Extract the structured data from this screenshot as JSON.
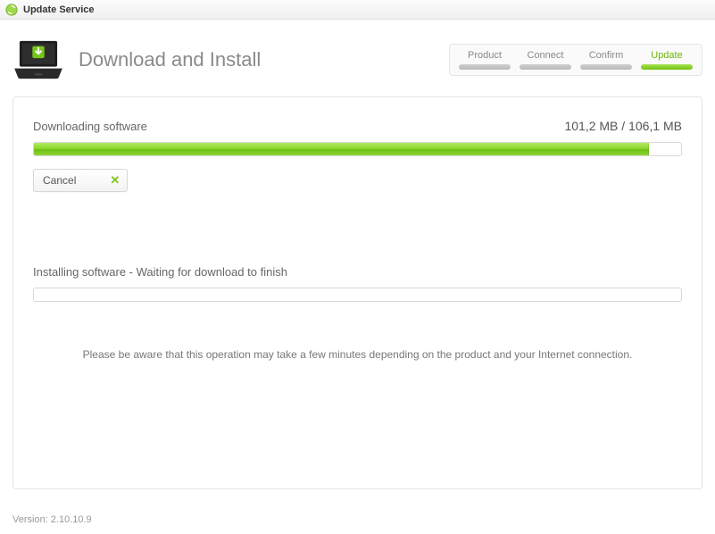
{
  "titlebar": {
    "title": "Update Service"
  },
  "header": {
    "page_title": "Download and Install"
  },
  "steps": [
    {
      "label": "Product",
      "active": false
    },
    {
      "label": "Connect",
      "active": false
    },
    {
      "label": "Confirm",
      "active": false
    },
    {
      "label": "Update",
      "active": true
    }
  ],
  "download": {
    "label": "Downloading software",
    "size_text": "101,2 MB / 106,1 MB",
    "progress_percent": 95,
    "cancel_label": "Cancel"
  },
  "install": {
    "label": "Installing software - Waiting for download to finish",
    "progress_percent": 0
  },
  "note": "Please be aware that this operation may take a few minutes depending on the product and your Internet connection.",
  "footer": {
    "version": "Version: 2.10.10.9"
  }
}
